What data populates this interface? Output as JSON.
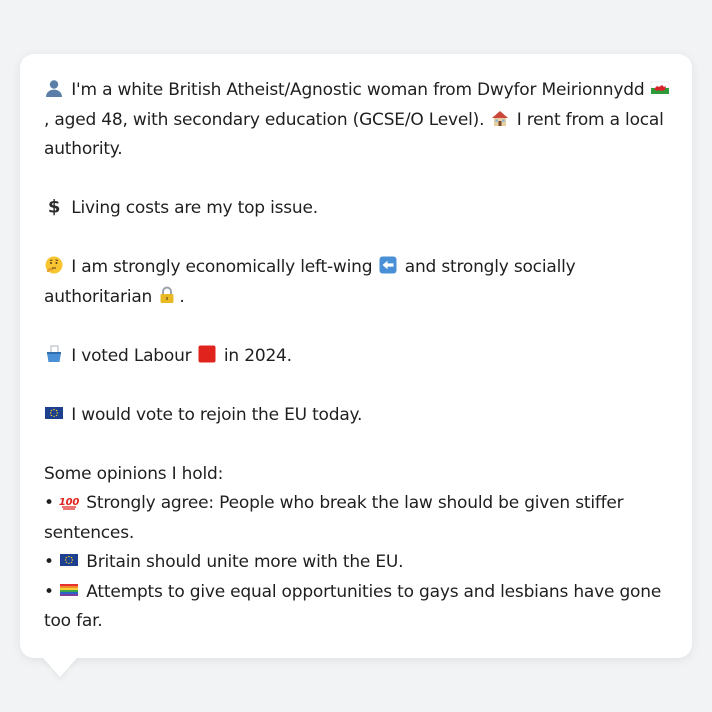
{
  "intro": {
    "part1": "I'm a white British Atheist/Agnostic woman from Dwyfor Meirionnydd",
    "part2": ", aged 48, with secondary education (GCSE/O Level).",
    "part3": "I rent from a local authority."
  },
  "issue": {
    "text": "Living costs are my top issue."
  },
  "politics": {
    "part1": "I am strongly economically left-wing",
    "part2": "and strongly socially authoritarian",
    "part3": "."
  },
  "vote": {
    "part1": "I voted Labour",
    "part2": "in 2024."
  },
  "eu": {
    "text": "I would vote to rejoin the EU today."
  },
  "opinions": {
    "heading": "Some opinions I hold:",
    "items": [
      {
        "bullet": "•",
        "text": "Strongly agree: People who break the law should be given stiffer sentences."
      },
      {
        "bullet": "•",
        "text": "Britain should unite more with the EU."
      },
      {
        "bullet": "•",
        "text": "Attempts to give equal opportunities to gays and lesbians have gone too far."
      }
    ]
  },
  "icons": {
    "person": "bust-in-silhouette-icon",
    "wales_flag": "wales-flag-icon",
    "house": "house-icon",
    "dollar": "dollar-sign-icon",
    "thinking": "thinking-face-icon",
    "left_arrow": "left-arrow-icon",
    "lock": "lock-icon",
    "ballot": "ballot-box-icon",
    "red_square": "red-square-icon",
    "eu_flag": "eu-flag-icon",
    "hundred": "hundred-points-icon",
    "rainbow_flag": "rainbow-flag-icon"
  },
  "colors": {
    "background": "#f1f3f5",
    "bubble": "#ffffff",
    "text": "#1f1f1f",
    "labour_red": "#e0231c",
    "eu_blue": "#1d3f8f"
  }
}
